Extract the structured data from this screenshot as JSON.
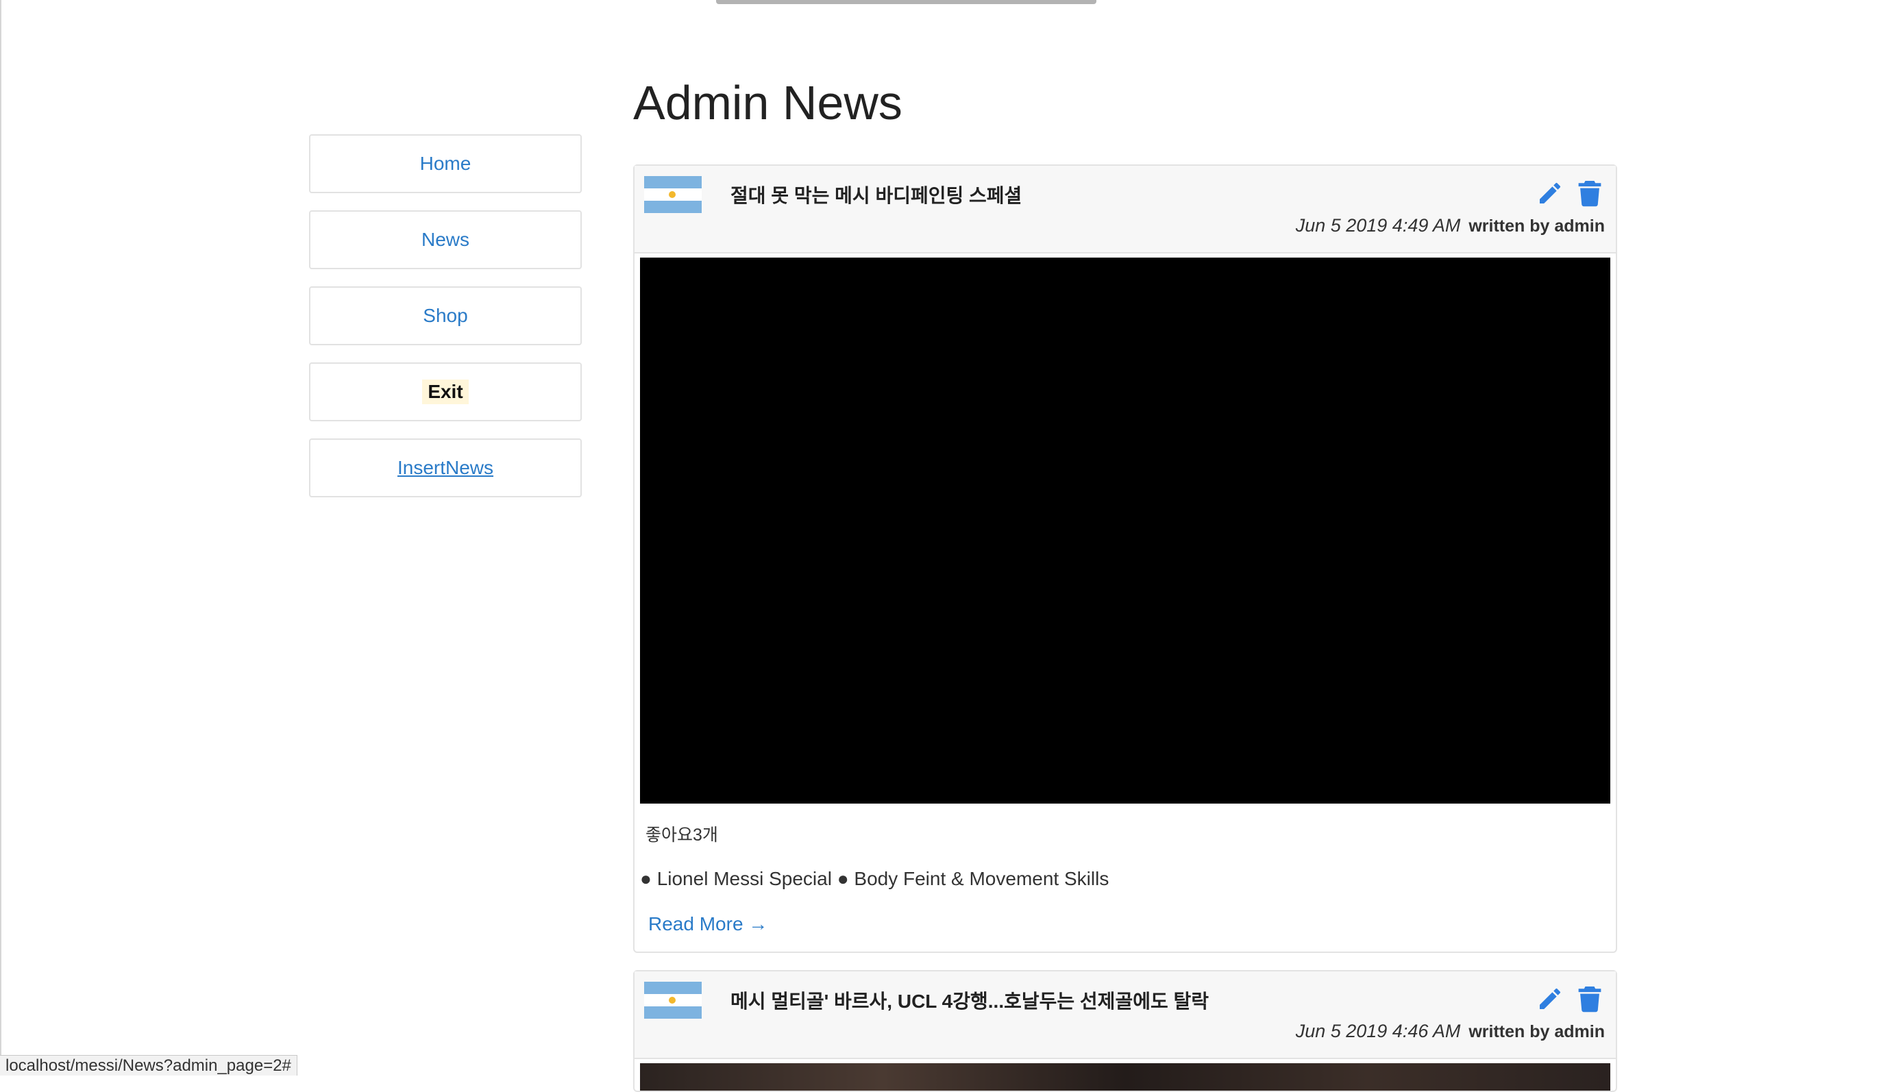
{
  "page": {
    "title": "Admin News"
  },
  "sidebar": {
    "items": [
      {
        "label": "Home"
      },
      {
        "label": "News"
      },
      {
        "label": "Shop"
      },
      {
        "label": "Exit"
      },
      {
        "label": "InsertNews"
      }
    ]
  },
  "news": [
    {
      "title": "절대 못 막는 메시 바디페인팅 스페셜",
      "date": "Jun 5 2019 4:49 AM",
      "author": "written by admin",
      "likes": "좋아요3개",
      "summary": "● Lionel Messi Special ● Body Feint & Movement Skills",
      "read_more": "Read More →"
    },
    {
      "title": "메시 멀티골' 바르사, UCL 4강행...호날두는 선제골에도 탈락",
      "date": "Jun 5 2019 4:46 AM",
      "author": "written by admin"
    }
  ],
  "icons": {
    "edit": "pencil-icon",
    "delete": "trash-icon",
    "flag": "argentina-flag-icon"
  },
  "colors": {
    "accent": "#2a7bc8",
    "icon_blue": "#2f7fe0"
  },
  "status_bar": {
    "url": "localhost/messi/News?admin_page=2#"
  }
}
